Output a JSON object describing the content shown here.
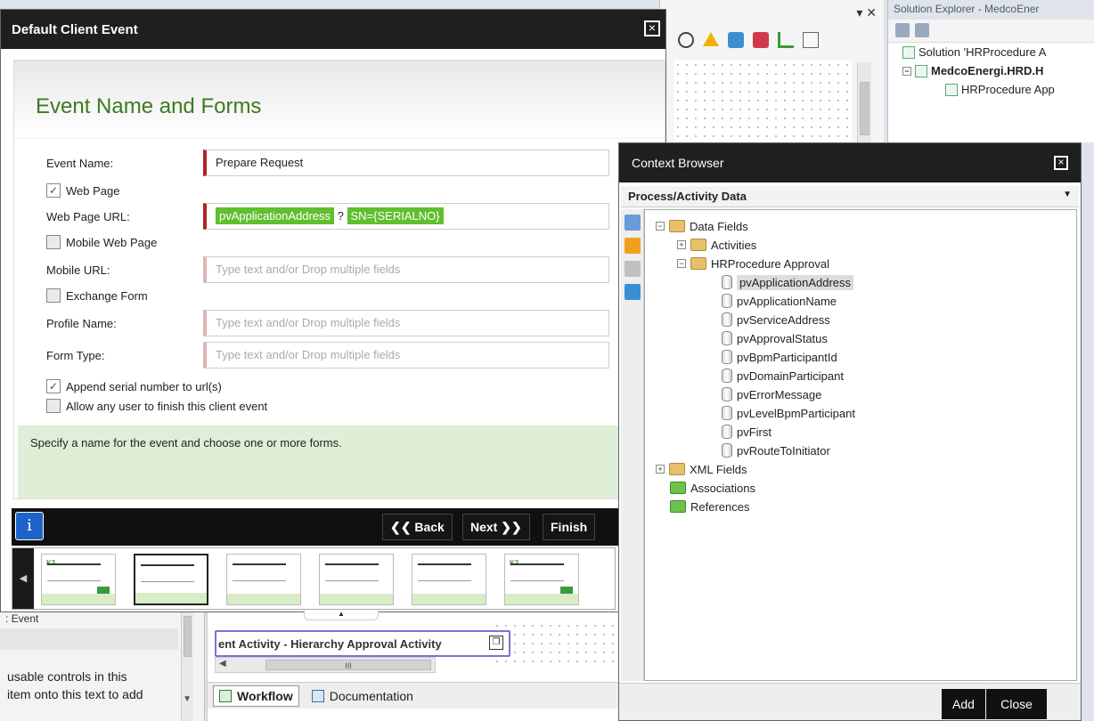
{
  "bg": {
    "solution_explorer_title": "Solution Explorer - MedcoEner",
    "solution_node": "Solution 'HRProcedure A",
    "project_node": "MedcoEnergi.HRD.H",
    "file_node": "HRProcedure App",
    "left_panel_title": ": Event",
    "left_panel_hint_line1": "usable controls in this",
    "left_panel_hint_line2": "item onto this text to add",
    "activity_label": "ent Activity - Hierarchy Approval Activity",
    "hscroll_mark": "III",
    "tab_workflow": "Workflow",
    "tab_documentation": "Documentation"
  },
  "dialog": {
    "title": "Default Client Event",
    "heading": "Event Name and Forms",
    "event_name_label": "Event Name:",
    "event_name_value": "Prepare Request",
    "web_page_label": "Web Page",
    "web_page_checked": true,
    "web_page_url_label": "Web Page URL:",
    "url_chip1": "pvApplicationAddress",
    "url_sep": "?",
    "url_chip2": "SN={SERIALNO}",
    "mobile_web_page_label": "Mobile Web Page",
    "mobile_url_label": "Mobile URL:",
    "exchange_form_label": "Exchange Form",
    "profile_name_label": "Profile Name:",
    "form_type_label": "Form Type:",
    "placeholder": "Type text and/or Drop multiple fields",
    "append_serial_label": "Append serial number to url(s)",
    "append_serial_checked": true,
    "allow_any_user_label": "Allow any user to finish this client event",
    "hint": "Specify a name for the event and choose one or more forms.",
    "btn_back": "Back",
    "btn_next": "Next",
    "btn_finish": "Finish",
    "thumb_logo_text": "K2"
  },
  "context_browser": {
    "title": "Context Browser",
    "combo_value": "Process/Activity Data",
    "tree": {
      "data_fields": "Data Fields",
      "activities": "Activities",
      "hr_procedure": "HRProcedure Approval",
      "fields": [
        "pvApplicationAddress",
        "pvApplicationName",
        "pvServiceAddress",
        "pvApprovalStatus",
        "pvBpmParticipantId",
        "pvDomainParticipant",
        "pvErrorMessage",
        "pvLevelBpmParticipant",
        "pvFirst",
        "pvRouteToInitiator"
      ],
      "selected": "pvApplicationAddress",
      "xml_fields": "XML Fields",
      "associations": "Associations",
      "references": "References"
    },
    "btn_add": "Add",
    "btn_close": "Close"
  },
  "colors": {
    "accent_green": "#5fbf2e",
    "required_red": "#b0232a",
    "heading_green": "#3e7a1e"
  }
}
